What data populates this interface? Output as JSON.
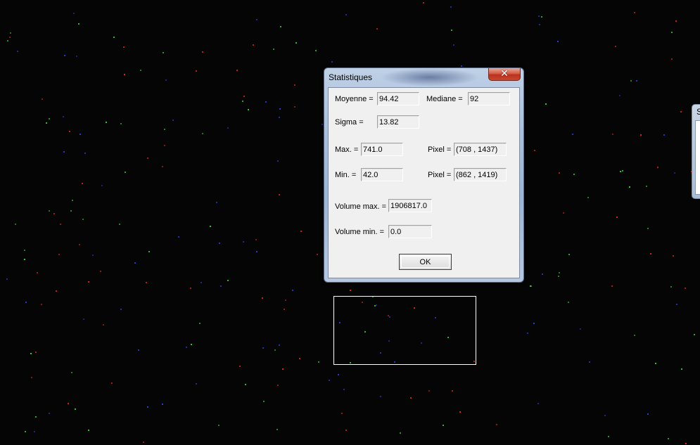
{
  "dialog": {
    "title": "Statistiques",
    "close_symbol": "✕",
    "moyenne_label": "Moyenne =",
    "moyenne_value": "94.42",
    "mediane_label": "Mediane =",
    "mediane_value": "92",
    "sigma_label": "Sigma =",
    "sigma_value": "13.82",
    "max_label": "Max. =",
    "max_value": "741.0",
    "max_pixel_label": "Pixel =",
    "max_pixel_value": "(708 , 1437)",
    "min_label": "Min. =",
    "min_value": "42.0",
    "min_pixel_label": "Pixel =",
    "min_pixel_value": "(862 , 1419)",
    "volume_max_label": "Volume max. =",
    "volume_max_value": "1906817.0",
    "volume_min_label": "Volume min. =",
    "volume_min_value": "0.0",
    "ok_label": "OK"
  },
  "background_window": {
    "title_fragment": "S"
  },
  "colors": {
    "background": "#050505",
    "star_green": "#2bd32b",
    "star_red": "#e02020",
    "star_blue": "#2a3ad8",
    "selection_border": "#ffffff"
  },
  "icons": {
    "close": "close-icon"
  }
}
